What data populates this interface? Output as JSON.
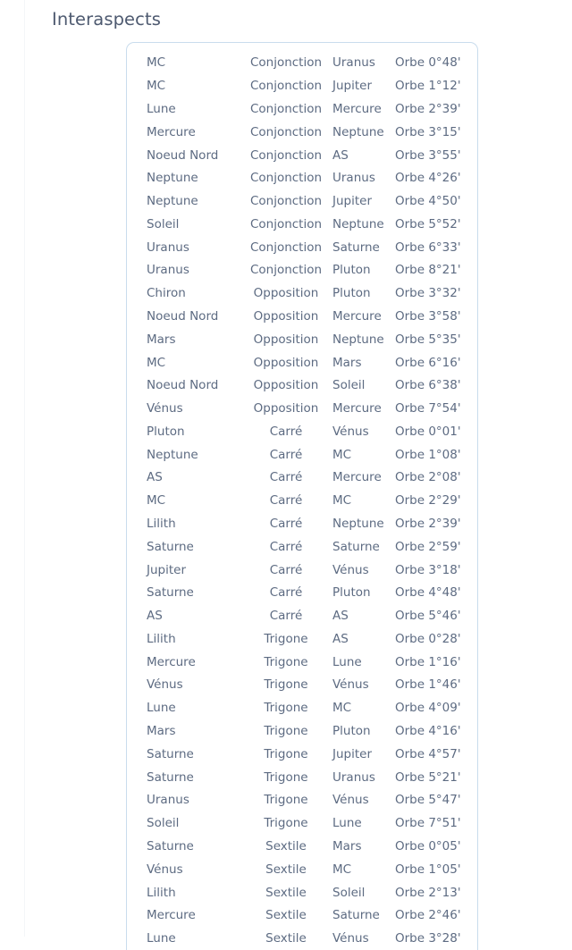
{
  "page": {
    "title": "Interaspects"
  },
  "table": {
    "orb_prefix": "Orbe",
    "rows": [
      {
        "body1": "MC",
        "aspect": "Conjonction",
        "body2": "Uranus",
        "orb": "Orbe 0°48'"
      },
      {
        "body1": "MC",
        "aspect": "Conjonction",
        "body2": "Jupiter",
        "orb": "Orbe 1°12'"
      },
      {
        "body1": "Lune",
        "aspect": "Conjonction",
        "body2": "Mercure",
        "orb": "Orbe 2°39'"
      },
      {
        "body1": "Mercure",
        "aspect": "Conjonction",
        "body2": "Neptune",
        "orb": "Orbe 3°15'"
      },
      {
        "body1": "Noeud Nord",
        "aspect": "Conjonction",
        "body2": "AS",
        "orb": "Orbe 3°55'"
      },
      {
        "body1": "Neptune",
        "aspect": "Conjonction",
        "body2": "Uranus",
        "orb": "Orbe 4°26'"
      },
      {
        "body1": "Neptune",
        "aspect": "Conjonction",
        "body2": "Jupiter",
        "orb": "Orbe 4°50'"
      },
      {
        "body1": "Soleil",
        "aspect": "Conjonction",
        "body2": "Neptune",
        "orb": "Orbe 5°52'"
      },
      {
        "body1": "Uranus",
        "aspect": "Conjonction",
        "body2": "Saturne",
        "orb": "Orbe 6°33'"
      },
      {
        "body1": "Uranus",
        "aspect": "Conjonction",
        "body2": "Pluton",
        "orb": "Orbe 8°21'"
      },
      {
        "body1": "Chiron",
        "aspect": "Opposition",
        "body2": "Pluton",
        "orb": "Orbe 3°32'"
      },
      {
        "body1": "Noeud Nord",
        "aspect": "Opposition",
        "body2": "Mercure",
        "orb": "Orbe 3°58'"
      },
      {
        "body1": "Mars",
        "aspect": "Opposition",
        "body2": "Neptune",
        "orb": "Orbe 5°35'"
      },
      {
        "body1": "MC",
        "aspect": "Opposition",
        "body2": "Mars",
        "orb": "Orbe 6°16'"
      },
      {
        "body1": "Noeud Nord",
        "aspect": "Opposition",
        "body2": "Soleil",
        "orb": "Orbe 6°38'"
      },
      {
        "body1": "Vénus",
        "aspect": "Opposition",
        "body2": "Mercure",
        "orb": "Orbe 7°54'"
      },
      {
        "body1": "Pluton",
        "aspect": "Carré",
        "body2": "Vénus",
        "orb": "Orbe 0°01'"
      },
      {
        "body1": "Neptune",
        "aspect": "Carré",
        "body2": "MC",
        "orb": "Orbe 1°08'"
      },
      {
        "body1": "AS",
        "aspect": "Carré",
        "body2": "Mercure",
        "orb": "Orbe 2°08'"
      },
      {
        "body1": "MC",
        "aspect": "Carré",
        "body2": "MC",
        "orb": "Orbe 2°29'"
      },
      {
        "body1": "Lilith",
        "aspect": "Carré",
        "body2": "Neptune",
        "orb": "Orbe 2°39'"
      },
      {
        "body1": "Saturne",
        "aspect": "Carré",
        "body2": "Saturne",
        "orb": "Orbe 2°59'"
      },
      {
        "body1": "Jupiter",
        "aspect": "Carré",
        "body2": "Vénus",
        "orb": "Orbe 3°18'"
      },
      {
        "body1": "Saturne",
        "aspect": "Carré",
        "body2": "Pluton",
        "orb": "Orbe 4°48'"
      },
      {
        "body1": "AS",
        "aspect": "Carré",
        "body2": "AS",
        "orb": "Orbe 5°46'"
      },
      {
        "body1": "Lilith",
        "aspect": "Trigone",
        "body2": "AS",
        "orb": "Orbe 0°28'"
      },
      {
        "body1": "Mercure",
        "aspect": "Trigone",
        "body2": "Lune",
        "orb": "Orbe 1°16'"
      },
      {
        "body1": "Vénus",
        "aspect": "Trigone",
        "body2": "Vénus",
        "orb": "Orbe 1°46'"
      },
      {
        "body1": "Lune",
        "aspect": "Trigone",
        "body2": "MC",
        "orb": "Orbe 4°09'"
      },
      {
        "body1": "Mars",
        "aspect": "Trigone",
        "body2": "Pluton",
        "orb": "Orbe 4°16'"
      },
      {
        "body1": "Saturne",
        "aspect": "Trigone",
        "body2": "Jupiter",
        "orb": "Orbe 4°57'"
      },
      {
        "body1": "Saturne",
        "aspect": "Trigone",
        "body2": "Uranus",
        "orb": "Orbe 5°21'"
      },
      {
        "body1": "Uranus",
        "aspect": "Trigone",
        "body2": "Vénus",
        "orb": "Orbe 5°47'"
      },
      {
        "body1": "Soleil",
        "aspect": "Trigone",
        "body2": "Lune",
        "orb": "Orbe 7°51'"
      },
      {
        "body1": "Saturne",
        "aspect": "Sextile",
        "body2": "Mars",
        "orb": "Orbe 0°05'"
      },
      {
        "body1": "Vénus",
        "aspect": "Sextile",
        "body2": "MC",
        "orb": "Orbe 1°05'"
      },
      {
        "body1": "Lilith",
        "aspect": "Sextile",
        "body2": "Soleil",
        "orb": "Orbe 2°13'"
      },
      {
        "body1": "Mercure",
        "aspect": "Sextile",
        "body2": "Saturne",
        "orb": "Orbe 2°46'"
      },
      {
        "body1": "Lune",
        "aspect": "Sextile",
        "body2": "Vénus",
        "orb": "Orbe 3°28'"
      }
    ]
  },
  "colors": {
    "title": "#4e5a70",
    "text": "#5d6b82",
    "card_border": "#c9dced",
    "page_background": "#ffffff"
  }
}
